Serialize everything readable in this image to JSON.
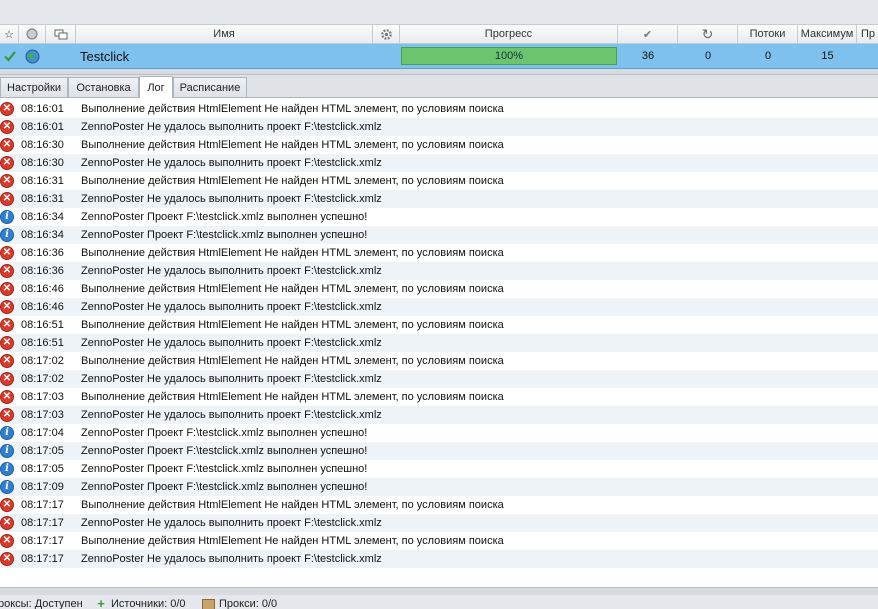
{
  "header": {
    "columns": {
      "star": "☆",
      "globe": "",
      "windows": "",
      "name": "Имя",
      "gear": "",
      "progress": "Прогресс",
      "done": "✔",
      "repeat": "↻",
      "threads": "Потоки",
      "maximum": "Максимум",
      "priority": "Пр"
    }
  },
  "task": {
    "name": "Testclick",
    "progress_text": "100%",
    "progress_fraction": 1.0,
    "success": "36",
    "repeats": "0",
    "threads": "0",
    "maximum": "15"
  },
  "tabs": [
    {
      "label": "Настройки",
      "active": false
    },
    {
      "label": "Остановка",
      "active": false
    },
    {
      "label": "Лог",
      "active": true
    },
    {
      "label": "Расписание",
      "active": false
    }
  ],
  "log": [
    {
      "type": "error",
      "time": "08:16:01",
      "msg": "Выполнение действия HtmlElement Не найден HTML элемент, по условиям поиска"
    },
    {
      "type": "error",
      "time": "08:16:01",
      "msg": "ZennoPoster Не удалось выполнить проект F:\\testclick.xmlz"
    },
    {
      "type": "error",
      "time": "08:16:30",
      "msg": "Выполнение действия HtmlElement Не найден HTML элемент, по условиям поиска"
    },
    {
      "type": "error",
      "time": "08:16:30",
      "msg": "ZennoPoster Не удалось выполнить проект F:\\testclick.xmlz"
    },
    {
      "type": "error",
      "time": "08:16:31",
      "msg": "Выполнение действия HtmlElement Не найден HTML элемент, по условиям поиска"
    },
    {
      "type": "error",
      "time": "08:16:31",
      "msg": "ZennoPoster Не удалось выполнить проект F:\\testclick.xmlz"
    },
    {
      "type": "info",
      "time": "08:16:34",
      "msg": "ZennoPoster Проект F:\\testclick.xmlz выполнен успешно!"
    },
    {
      "type": "info",
      "time": "08:16:34",
      "msg": "ZennoPoster Проект F:\\testclick.xmlz выполнен успешно!"
    },
    {
      "type": "error",
      "time": "08:16:36",
      "msg": "Выполнение действия HtmlElement Не найден HTML элемент, по условиям поиска"
    },
    {
      "type": "error",
      "time": "08:16:36",
      "msg": "ZennoPoster Не удалось выполнить проект F:\\testclick.xmlz"
    },
    {
      "type": "error",
      "time": "08:16:46",
      "msg": "Выполнение действия HtmlElement Не найден HTML элемент, по условиям поиска"
    },
    {
      "type": "error",
      "time": "08:16:46",
      "msg": "ZennoPoster Не удалось выполнить проект F:\\testclick.xmlz"
    },
    {
      "type": "error",
      "time": "08:16:51",
      "msg": "Выполнение действия HtmlElement Не найден HTML элемент, по условиям поиска"
    },
    {
      "type": "error",
      "time": "08:16:51",
      "msg": "ZennoPoster Не удалось выполнить проект F:\\testclick.xmlz"
    },
    {
      "type": "error",
      "time": "08:17:02",
      "msg": "Выполнение действия HtmlElement Не найден HTML элемент, по условиям поиска"
    },
    {
      "type": "error",
      "time": "08:17:02",
      "msg": "ZennoPoster Не удалось выполнить проект F:\\testclick.xmlz"
    },
    {
      "type": "error",
      "time": "08:17:03",
      "msg": "Выполнение действия HtmlElement Не найден HTML элемент, по условиям поиска"
    },
    {
      "type": "error",
      "time": "08:17:03",
      "msg": "ZennoPoster Не удалось выполнить проект F:\\testclick.xmlz"
    },
    {
      "type": "info",
      "time": "08:17:04",
      "msg": "ZennoPoster Проект F:\\testclick.xmlz выполнен успешно!"
    },
    {
      "type": "info",
      "time": "08:17:05",
      "msg": "ZennoPoster Проект F:\\testclick.xmlz выполнен успешно!"
    },
    {
      "type": "info",
      "time": "08:17:05",
      "msg": "ZennoPoster Проект F:\\testclick.xmlz выполнен успешно!"
    },
    {
      "type": "info",
      "time": "08:17:09",
      "msg": "ZennoPoster Проект F:\\testclick.xmlz выполнен успешно!"
    },
    {
      "type": "error",
      "time": "08:17:17",
      "msg": "Выполнение действия HtmlElement Не найден HTML элемент, по условиям поиска"
    },
    {
      "type": "error",
      "time": "08:17:17",
      "msg": "ZennoPoster Не удалось выполнить проект F:\\testclick.xmlz"
    },
    {
      "type": "error",
      "time": "08:17:17",
      "msg": "Выполнение действия HtmlElement Не найден HTML элемент, по условиям поиска"
    },
    {
      "type": "error",
      "time": "08:17:17",
      "msg": "ZennoPoster Не удалось выполнить проект F:\\testclick.xmlz"
    }
  ],
  "status_bar": {
    "proxy_status": "роксы: Доступен",
    "sources": "Источники: 0/0",
    "proxies": "Прокси: 0/0"
  },
  "colors": {
    "selected_row": "#7fc1ee",
    "progress_fill": "#6cc46c",
    "error_icon": "#d93a2b",
    "info_icon": "#2f7fd0"
  },
  "icons": {
    "error": "error-x-icon",
    "info": "info-i-icon"
  }
}
